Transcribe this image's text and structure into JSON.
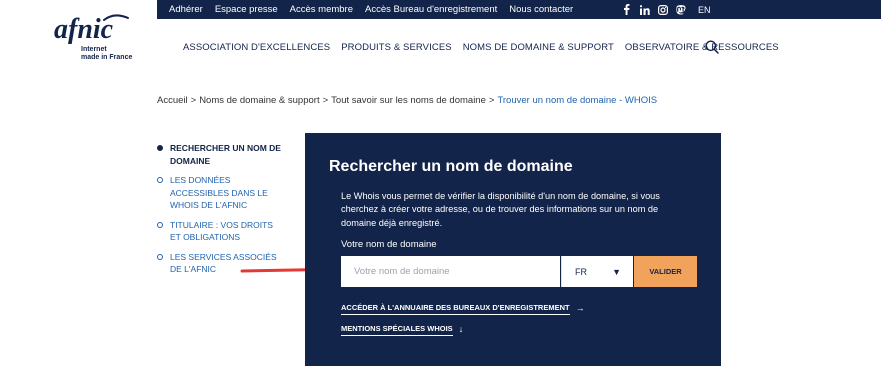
{
  "topbar": {
    "links": [
      "Adhérer",
      "Espace presse",
      "Accès membre",
      "Accès Bureau d'enregistrement",
      "Nous contacter"
    ],
    "social_icons": [
      "facebook-icon",
      "linkedin-icon",
      "instagram-icon",
      "mastodon-icon"
    ],
    "lang": "EN",
    "bg_color": "#13244a"
  },
  "logo": {
    "wordmark": "afnic",
    "tagline": "Internet\nmade in France"
  },
  "mainnav": {
    "items": [
      "ASSOCIATION D'EXCELLENCES",
      "PRODUITS & SERVICES",
      "NOMS DE DOMAINE & SUPPORT",
      "OBSERVATOIRE & RESSOURCES"
    ],
    "search_icon": "search-icon"
  },
  "breadcrumb": {
    "items": [
      "Accueil",
      "Noms de domaine & support",
      "Tout savoir sur les noms de domaine"
    ],
    "current": "Trouver un nom de domaine - WHOIS",
    "separator": ">"
  },
  "sidenav": {
    "items": [
      {
        "label": "RECHERCHER UN NOM DE DOMAINE",
        "active": true
      },
      {
        "label": "LES DONNÉES ACCESSIBLES DANS LE WHOIS DE L'AFNIC",
        "active": false
      },
      {
        "label": "TITULAIRE : VOS DROITS ET OBLIGATIONS",
        "active": false
      },
      {
        "label": "LES SERVICES ASSOCIÉS DE L'AFNIC",
        "active": false
      }
    ]
  },
  "panel": {
    "title": "Rechercher un nom de domaine",
    "description": "Le Whois vous permet de vérifier la disponibilité d'un nom de domaine, si vous cherchez à créer votre adresse, ou de trouver des informations sur un nom de domaine déjà enregistré.",
    "field_label": "Votre nom de domaine",
    "input_placeholder": "Votre nom de domaine",
    "input_value": "",
    "tld_selected": "FR",
    "submit_label": "VALIDER",
    "link_registrars": "ACCÉDER À L'ANNUAIRE DES BUREAUX D'ENREGISTREMENT",
    "link_mentions": "MENTIONS SPÉCIALES WHOIS",
    "bg_color": "#13244a",
    "accent_color": "#f2a35b"
  },
  "annotation": {
    "arrow_color": "#e53935"
  }
}
